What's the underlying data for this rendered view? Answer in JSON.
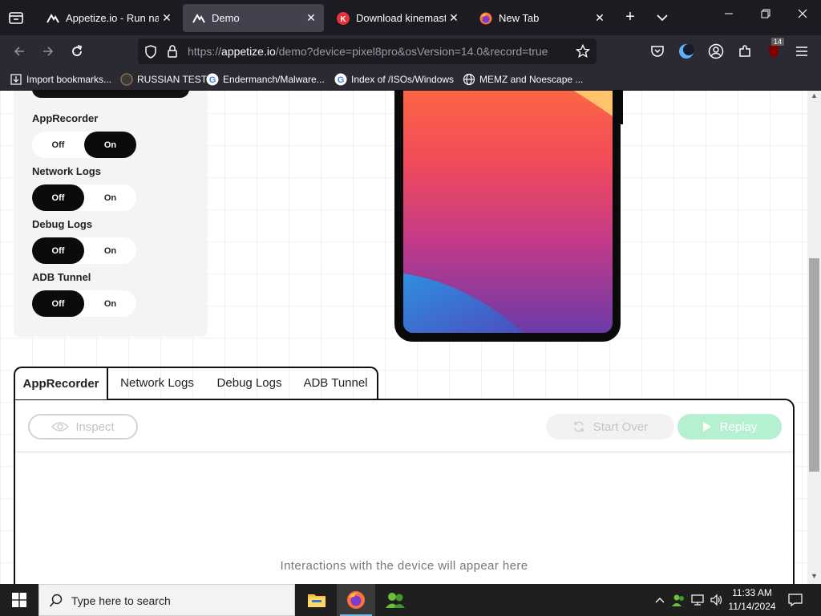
{
  "browser": {
    "tabs": [
      {
        "title": "Appetize.io - Run nativ",
        "icon": "appetize-logo-icon",
        "active": false
      },
      {
        "title": "Demo",
        "icon": "appetize-logo-icon",
        "active": true
      },
      {
        "title": "Download kinemaster",
        "icon": "kinemaster-icon",
        "active": false
      },
      {
        "title": "New Tab",
        "icon": "firefox-icon",
        "active": false
      }
    ],
    "url": {
      "prefix": "https://",
      "host": "appetize.io",
      "path": "/demo?device=pixel8pro&osVersion=14.0&record=true"
    },
    "extension_badge": "14",
    "bookmarks": [
      {
        "label": "Import bookmarks...",
        "icon": "import-icon"
      },
      {
        "label": "RUSSIAN TEST",
        "icon": "bookmark-favicon"
      },
      {
        "label": "Endermanch/Malware...",
        "icon": "google-icon"
      },
      {
        "label": "Index of /ISOs/Windows",
        "icon": "google-icon"
      },
      {
        "label": "MEMZ and Noescape ...",
        "icon": "globe-icon"
      }
    ]
  },
  "settings": {
    "items": [
      {
        "label": "AppRecorder",
        "off": "Off",
        "on": "On",
        "selected": "on"
      },
      {
        "label": "Network Logs",
        "off": "Off",
        "on": "On",
        "selected": "off"
      },
      {
        "label": "Debug Logs",
        "off": "Off",
        "on": "On",
        "selected": "off"
      },
      {
        "label": "ADB Tunnel",
        "off": "Off",
        "on": "On",
        "selected": "off"
      }
    ]
  },
  "devtools": {
    "tabs": [
      "AppRecorder",
      "Network Logs",
      "Debug Logs",
      "ADB Tunnel"
    ],
    "active_tab": "AppRecorder",
    "inspect_label": "Inspect",
    "start_over_label": "Start Over",
    "replay_label": "Replay",
    "empty_message": "Interactions with the device will appear here"
  },
  "taskbar": {
    "search_placeholder": "Type here to search",
    "time": "11:33 AM",
    "date": "11/14/2024"
  },
  "colors": {
    "replay_bg": "#b5f0d0",
    "toggle_selected": "#0b0b0b",
    "browser_bg": "#1c1b22"
  }
}
